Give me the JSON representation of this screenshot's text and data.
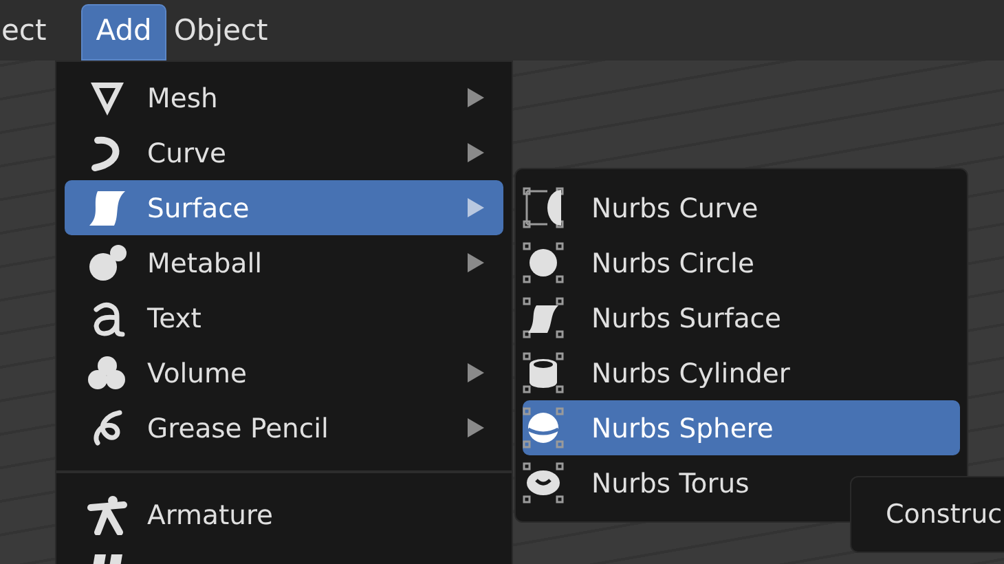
{
  "header": {
    "menus": [
      {
        "label": "ect",
        "selected": false
      },
      {
        "label": "Add",
        "selected": true
      },
      {
        "label": "Object",
        "selected": false
      }
    ]
  },
  "add_menu": {
    "groups": [
      [
        {
          "label": "Mesh",
          "has_submenu": true,
          "selected": false
        },
        {
          "label": "Curve",
          "has_submenu": true,
          "selected": false
        },
        {
          "label": "Surface",
          "has_submenu": true,
          "selected": true
        },
        {
          "label": "Metaball",
          "has_submenu": true,
          "selected": false
        },
        {
          "label": "Text",
          "has_submenu": false,
          "selected": false
        },
        {
          "label": "Volume",
          "has_submenu": true,
          "selected": false
        },
        {
          "label": "Grease Pencil",
          "has_submenu": true,
          "selected": false
        }
      ],
      [
        {
          "label": "Armature",
          "has_submenu": false,
          "selected": false
        },
        {
          "has_submenu": false,
          "selected": false
        }
      ]
    ]
  },
  "surface_submenu": {
    "items": [
      {
        "label": "Nurbs Curve",
        "selected": false
      },
      {
        "label": "Nurbs Circle",
        "selected": false
      },
      {
        "label": "Nurbs Surface",
        "selected": false
      },
      {
        "label": "Nurbs Cylinder",
        "selected": false
      },
      {
        "label": "Nurbs Sphere",
        "selected": true
      },
      {
        "label": "Nurbs Torus",
        "selected": false
      }
    ]
  },
  "tooltip": {
    "text": "Construc"
  }
}
